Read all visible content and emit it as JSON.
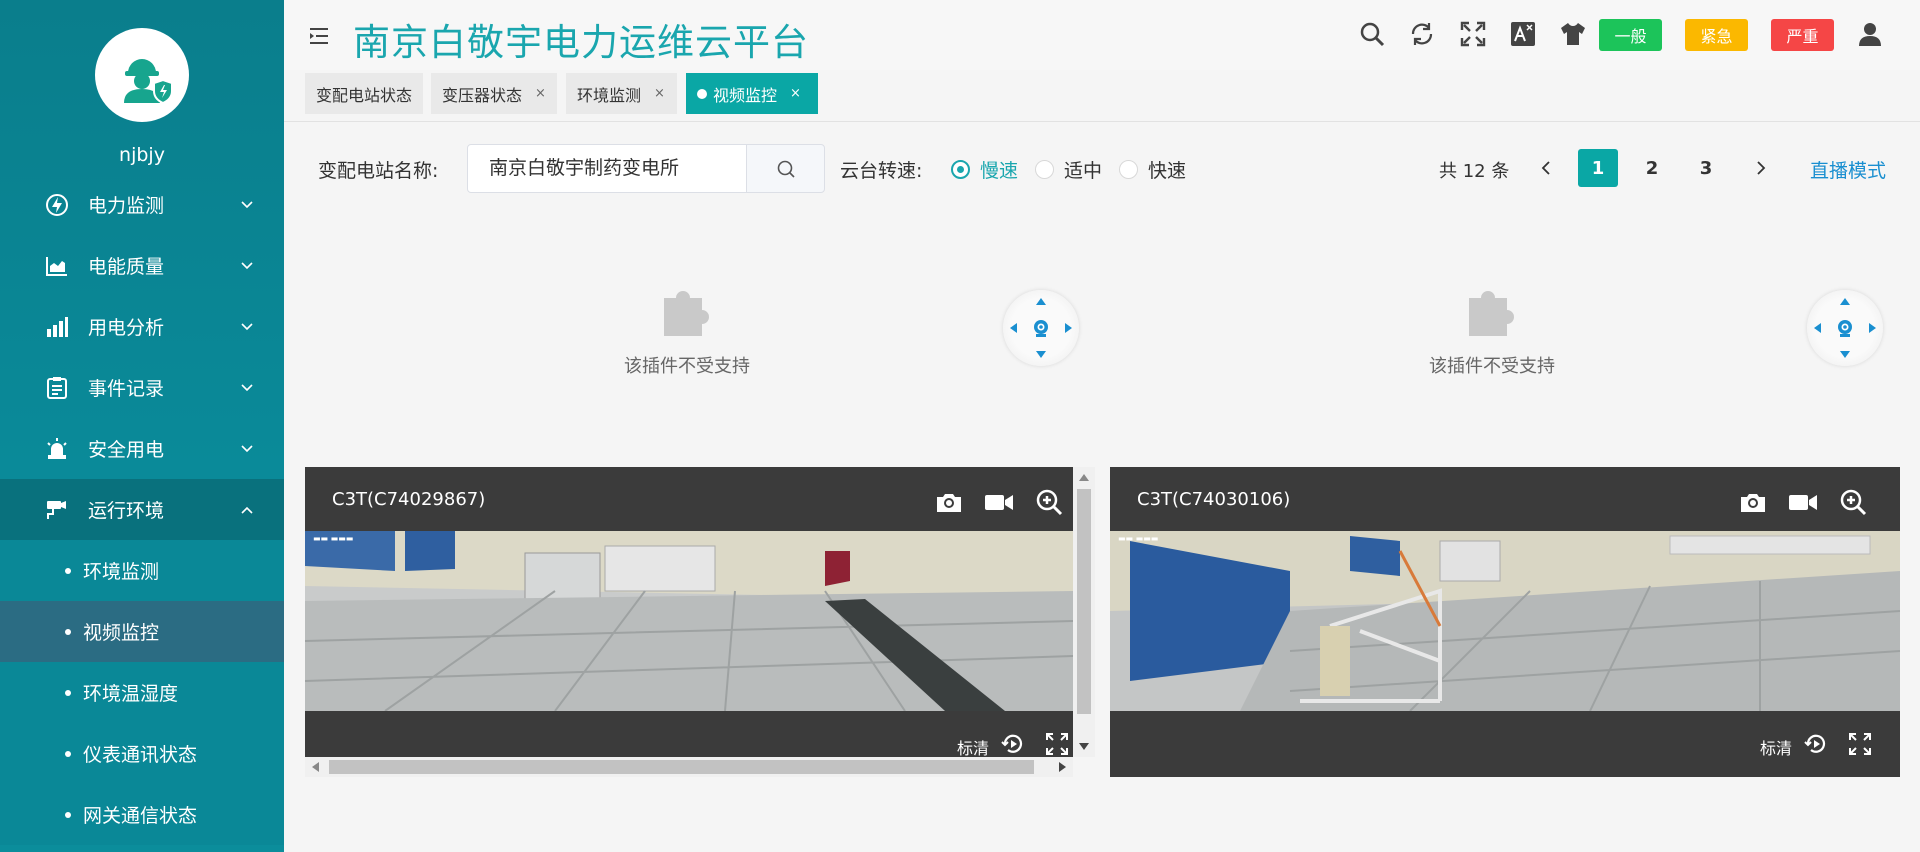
{
  "app": {
    "title": "南京白敬宇电力运维云平台"
  },
  "sidebar": {
    "username": "njbjy",
    "menu": [
      {
        "label": "电力监测",
        "icon": "lightning-icon"
      },
      {
        "label": "电能质量",
        "icon": "area-chart-icon"
      },
      {
        "label": "用电分析",
        "icon": "bar-chart-icon"
      },
      {
        "label": "事件记录",
        "icon": "clipboard-icon"
      },
      {
        "label": "安全用电",
        "icon": "alarm-light-icon"
      },
      {
        "label": "运行环境",
        "icon": "cctv-camera-icon"
      }
    ],
    "submenu": [
      {
        "label": "环境监测"
      },
      {
        "label": "视频监控"
      },
      {
        "label": "环境温湿度"
      },
      {
        "label": "仪表通讯状态"
      },
      {
        "label": "网关通信状态"
      }
    ]
  },
  "header": {
    "badges": {
      "normal": "一般",
      "urgent": "紧急",
      "severe": "严重"
    },
    "badge_colors": {
      "normal": "#1cc45a",
      "urgent": "#fbb800",
      "severe": "#f54646"
    }
  },
  "tabs": [
    {
      "label": "变配电站状态"
    },
    {
      "label": "变压器状态",
      "close": "×"
    },
    {
      "label": "环境监测",
      "close": "×"
    },
    {
      "label": "视频监控",
      "close": "×"
    }
  ],
  "filter": {
    "station_label": "变配电站名称:",
    "station_value": "南京白敬宇制药变电所",
    "ptz_label": "云台转速:",
    "speeds": [
      "慢速",
      "适中",
      "快速"
    ],
    "selected_speed": "慢速",
    "total": "共 12 条",
    "pages": [
      "1",
      "2",
      "3"
    ],
    "current_page": "1",
    "live_mode": "直播模式"
  },
  "plugins": [
    {
      "message": "该插件不受支持"
    },
    {
      "message": "该插件不受支持"
    }
  ],
  "videos": [
    {
      "title": "C3T(C74029867)",
      "quality": "标清"
    },
    {
      "title": "C3T(C74030106)",
      "quality": "标清"
    }
  ],
  "colors": {
    "sidebar": "#0a8a99",
    "accent": "#1aa6ae",
    "link": "#1a8fd0"
  }
}
